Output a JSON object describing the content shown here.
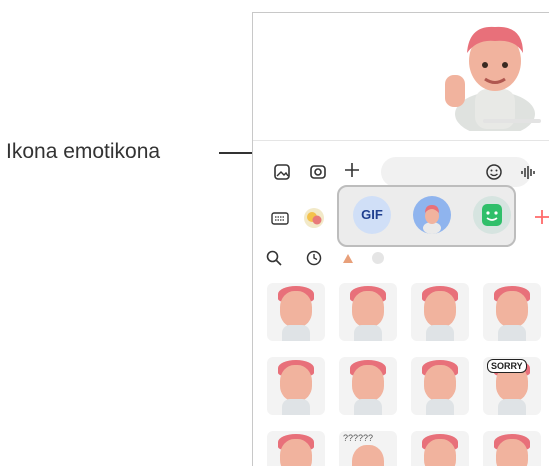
{
  "callout": {
    "label": "Ikona emotikona"
  },
  "tray": {
    "gif_label": "GIF"
  },
  "grid": {
    "text_marks": [
      "SORRY",
      "???",
      "??????"
    ]
  },
  "colors": {
    "accent": "#ff6a6a",
    "hair": "#e8707a",
    "skin": "#f1b39e"
  },
  "icons": [
    "gallery-icon",
    "camera-icon",
    "plus-icon",
    "emoji-icon",
    "voice-icon",
    "keyboard-icon",
    "bitmoji-icon",
    "search-icon",
    "clock-icon"
  ]
}
